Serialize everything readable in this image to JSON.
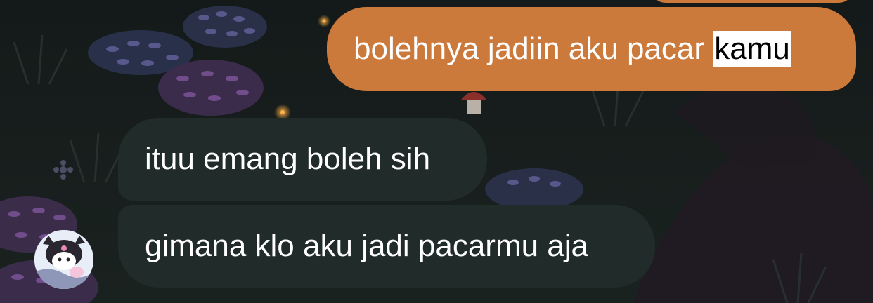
{
  "chat": {
    "messages": [
      {
        "direction": "outgoing",
        "text_before": "bolehnya jadiin aku pacar ",
        "selected_text": "kamu"
      },
      {
        "direction": "incoming",
        "text": "ituu emang boleh sih"
      },
      {
        "direction": "incoming",
        "text": "gimana klo aku jadi pacarmu aja"
      }
    ],
    "avatar_icon": "kuromi-avatar-icon"
  },
  "colors": {
    "outgoing_bubble": "#cc7a3c",
    "incoming_bubble": "#202b2a",
    "background": "#151c1a",
    "selection_highlight": "#ffffff"
  }
}
